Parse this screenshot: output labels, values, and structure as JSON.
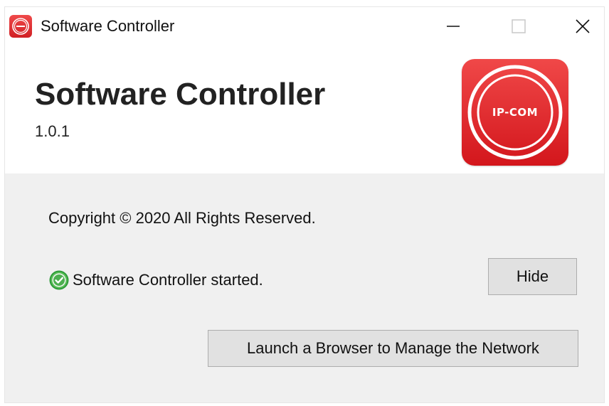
{
  "window": {
    "title": "Software Controller",
    "app_icon": "ip-com-logo-icon",
    "controls": {
      "minimize_icon": "minimize-icon",
      "maximize_icon": "maximize-icon",
      "close_icon": "close-icon"
    }
  },
  "header": {
    "product_name": "Software Controller",
    "version": "1.0.1",
    "logo_text": "IP-COM",
    "logo_color": "#e32a2e"
  },
  "body": {
    "copyright": "Copyright © 2020 All Rights Reserved.",
    "status": {
      "icon": "check-circle-icon",
      "text": "Software Controller started.",
      "color": "#4caf50"
    },
    "buttons": {
      "hide_label": "Hide",
      "launch_label": "Launch a Browser to Manage the Network"
    }
  }
}
